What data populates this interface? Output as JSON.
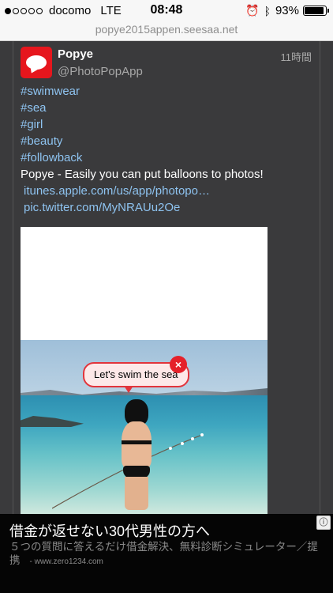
{
  "status_bar": {
    "carrier": "docomo",
    "network": "LTE",
    "time": "08:48",
    "battery": "93%",
    "battery_level": 0.93,
    "icons": [
      "alarm-icon",
      "bluetooth-icon"
    ]
  },
  "url_bar": {
    "url": "popye2015appen.seesaa.net"
  },
  "tweet": {
    "name": "Popye",
    "handle": "@PhotoPopApp",
    "timestamp": "11時間",
    "hashtags": [
      "#swimwear",
      "#sea",
      "#girl",
      "#beauty",
      "#followback"
    ],
    "text": "Popye - Easily you can put balloons to photos!",
    "links": [
      "itunes.apple.com/us/app/photopo…",
      "pic.twitter.com/MyNRAUu2Oe"
    ],
    "photo": {
      "balloon_text": "Let's swim the sea",
      "close_symbol": "×"
    }
  },
  "ad": {
    "title": "借金が返せない30代男性の方へ",
    "description": "５つの質問に答えるだけ借金解決、無料診断シミュレーター／提携",
    "domain": "- www.zero1234.com",
    "info_symbol": "ⓘ"
  }
}
